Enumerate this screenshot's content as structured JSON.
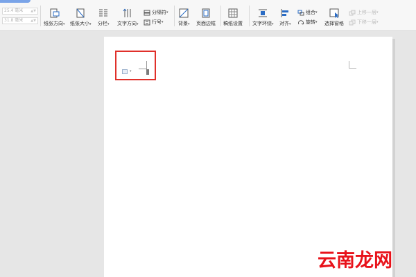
{
  "ribbon": {
    "margin_top_value": "25.4 毫米",
    "margin_bottom_value": "31.8 毫米",
    "page_orientation": "纸张方向",
    "page_size": "纸张大小",
    "columns": "分栏",
    "text_direction": "文字方向",
    "breaks": "分隔符",
    "line_numbers": "行号",
    "background": "背景",
    "page_border": "页面边框",
    "manuscript_setup": "稿纸设置",
    "text_wrap": "文字环绕",
    "align": "对齐",
    "group": "组合",
    "rotate": "旋转",
    "selection_pane": "选择窗格",
    "bring_forward": "上移一层",
    "send_backward": "下移一层"
  },
  "watermark": "云南龙网",
  "colors": {
    "highlight": "#e0302a",
    "watermark": "#e8121a",
    "tab_accent": "#7aa4e8"
  }
}
